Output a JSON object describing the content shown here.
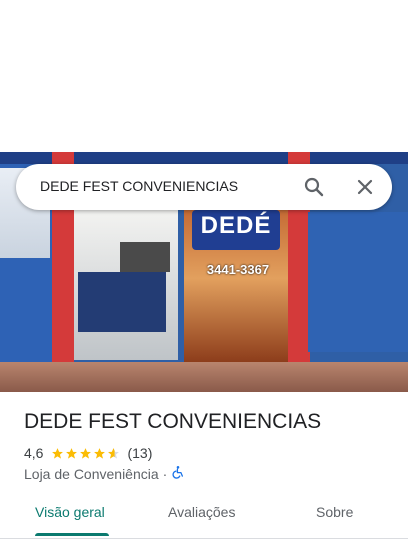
{
  "search": {
    "query": "DEDE FEST CONVENIENCIAS",
    "search_icon": "search-icon",
    "close_icon": "close-icon"
  },
  "photo": {
    "sign_text": "DEDÉ",
    "phone_text": "3441-3367"
  },
  "place": {
    "name": "DEDE FEST CONVENIENCIAS",
    "rating": "4,6",
    "rating_value": 4.6,
    "review_count": "(13)",
    "category": "Loja de Conveniência",
    "separator": "·",
    "accessibility_icon": "wheelchair-icon"
  },
  "tabs": [
    {
      "label": "Visão geral",
      "active": true
    },
    {
      "label": "Avaliações",
      "active": false
    },
    {
      "label": "Sobre",
      "active": false
    }
  ],
  "colors": {
    "accent": "#0b7a6f",
    "star": "#fbbc04",
    "accessibility": "#1a73e8"
  }
}
